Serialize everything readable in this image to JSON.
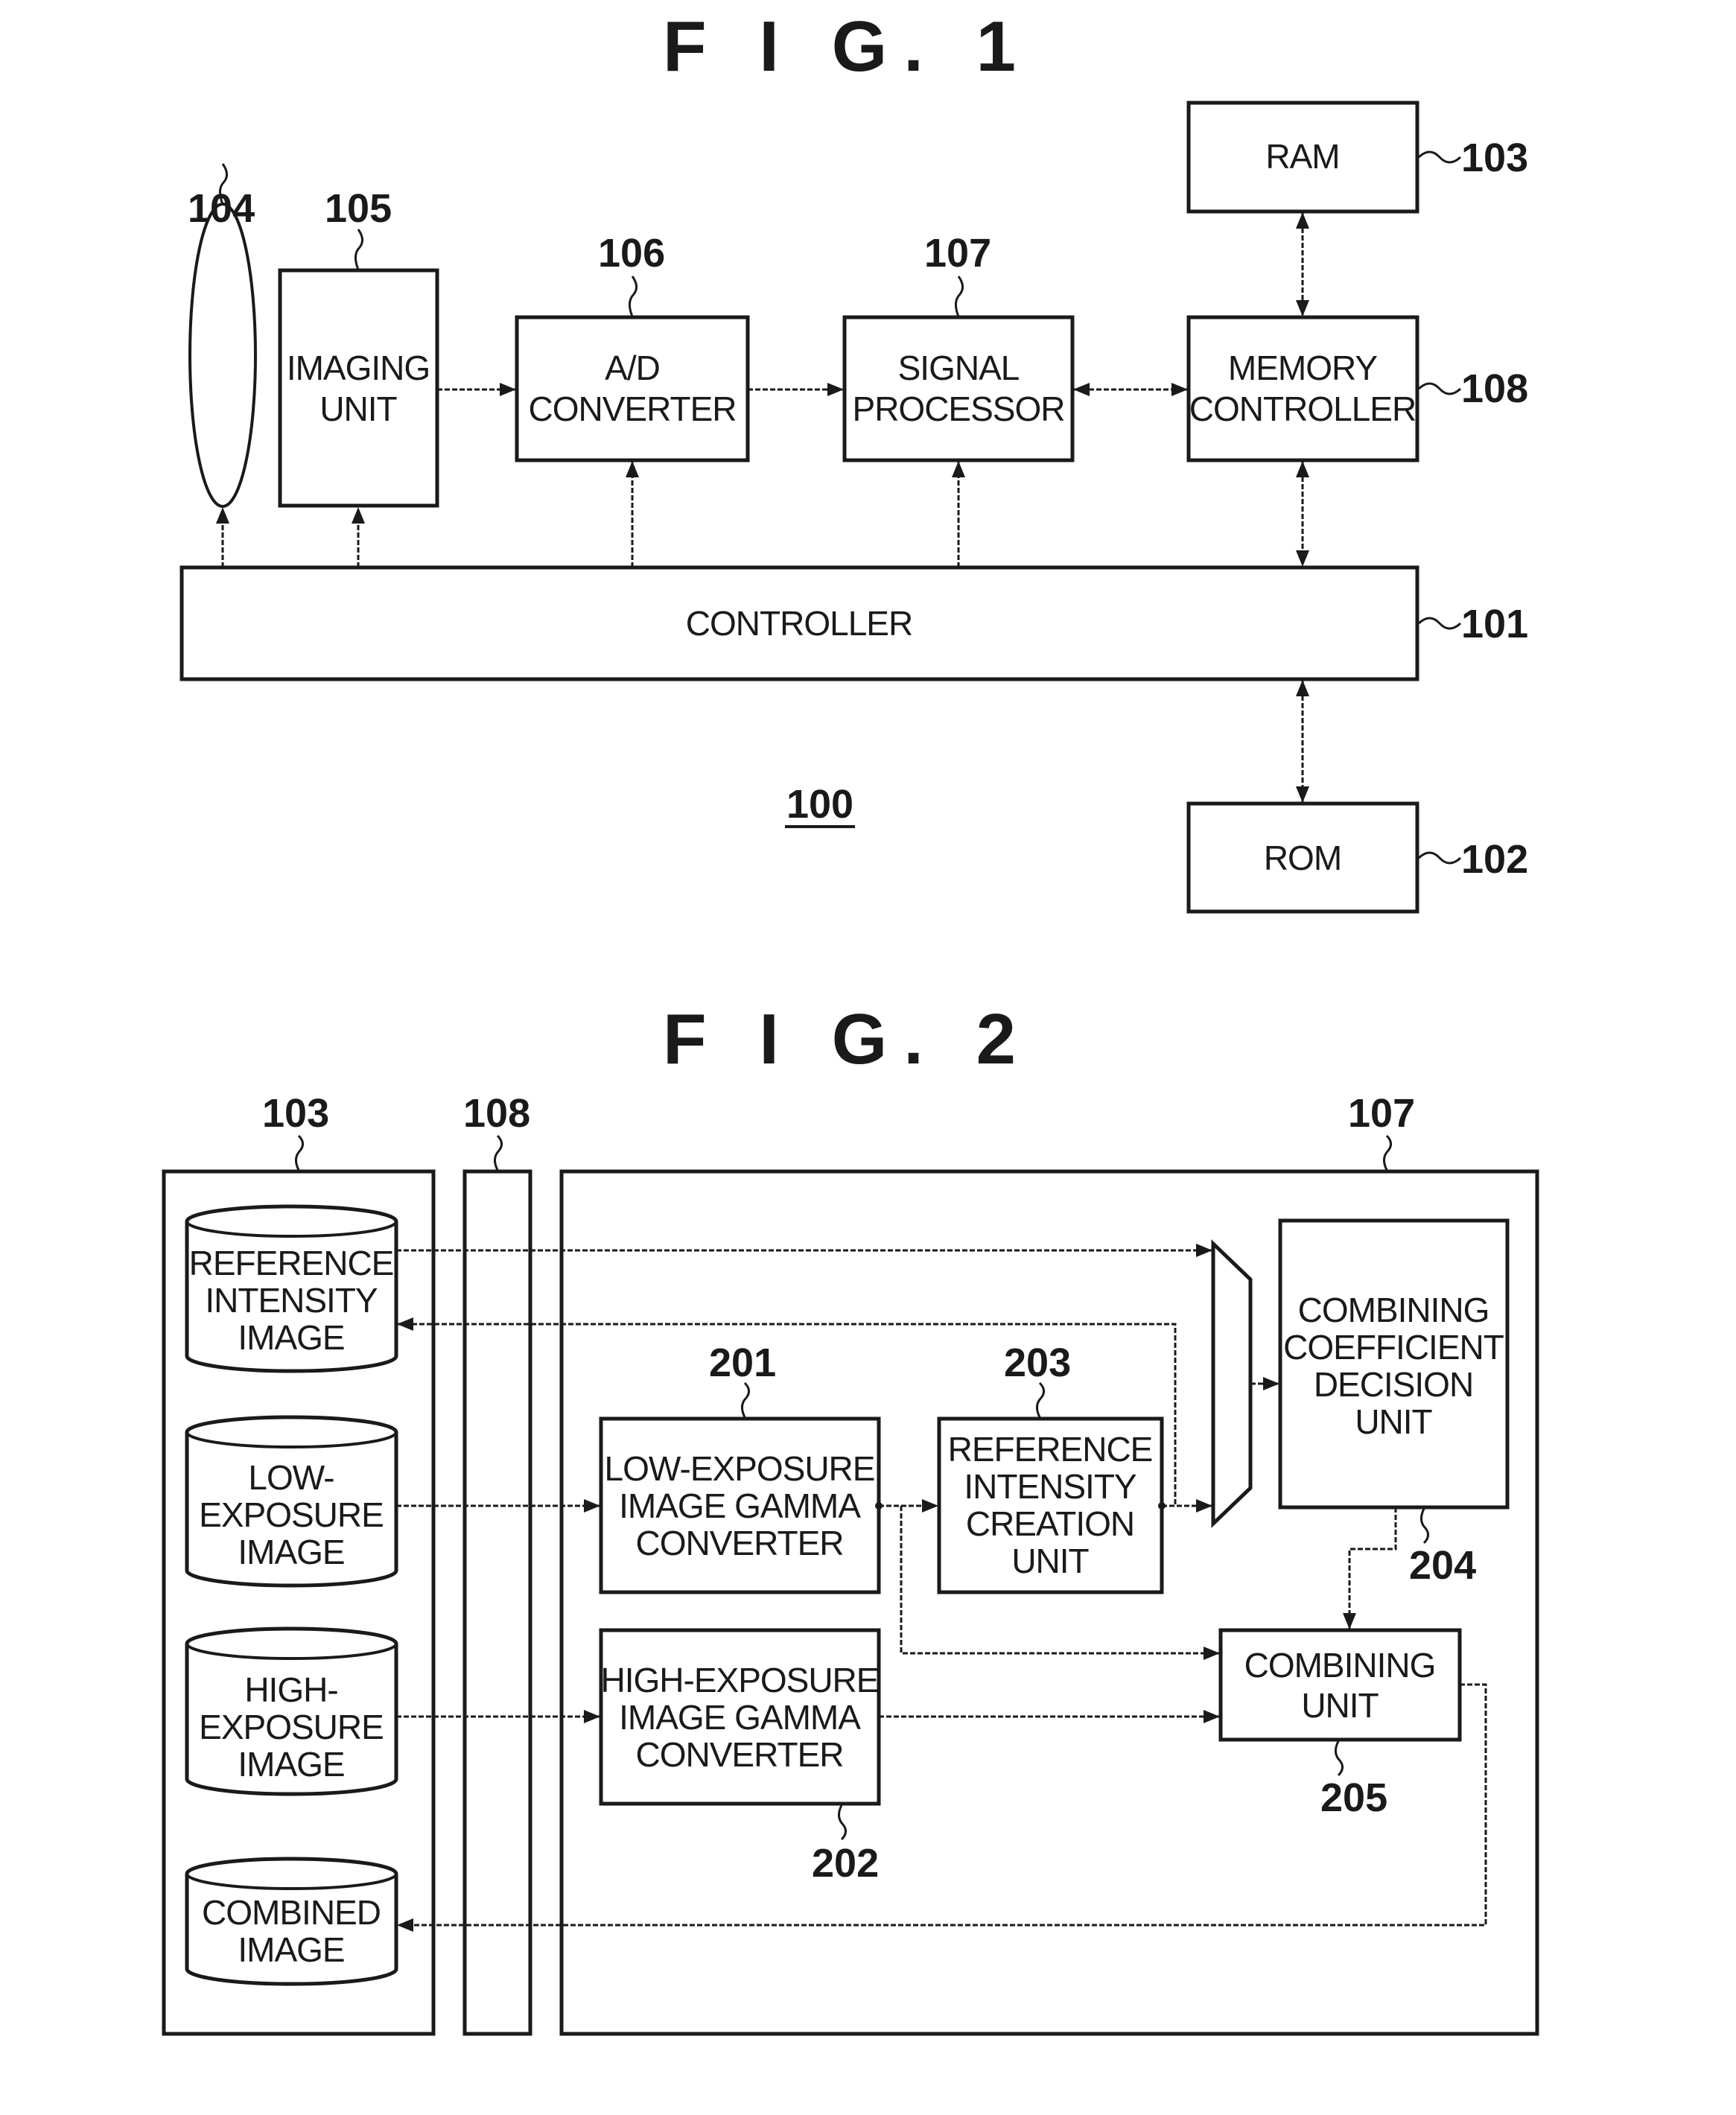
{
  "fig1": {
    "title": "F I G. 1",
    "system_label": "100",
    "blocks": {
      "lens": {
        "ref": "104"
      },
      "imaging_unit": {
        "ref": "105",
        "lines": [
          "IMAGING",
          "UNIT"
        ]
      },
      "ad_converter": {
        "ref": "106",
        "lines": [
          "A/D",
          "CONVERTER"
        ]
      },
      "signal_processor": {
        "ref": "107",
        "lines": [
          "SIGNAL",
          "PROCESSOR"
        ]
      },
      "memory_controller": {
        "ref": "108",
        "lines": [
          "MEMORY",
          "CONTROLLER"
        ]
      },
      "ram": {
        "ref": "103",
        "lines": [
          "RAM"
        ]
      },
      "controller": {
        "ref": "101",
        "lines": [
          "CONTROLLER"
        ]
      },
      "rom": {
        "ref": "102",
        "lines": [
          "ROM"
        ]
      }
    }
  },
  "fig2": {
    "title": "F I G. 2",
    "containers": {
      "ram": {
        "ref": "103"
      },
      "memory_controller": {
        "ref": "108"
      },
      "signal_processor": {
        "ref": "107"
      }
    },
    "storage": {
      "reference_intensity_image": {
        "lines": [
          "REFERENCE",
          "INTENSITY",
          "IMAGE"
        ]
      },
      "low_exposure_image": {
        "lines": [
          "LOW-",
          "EXPOSURE",
          "IMAGE"
        ]
      },
      "high_exposure_image": {
        "lines": [
          "HIGH-",
          "EXPOSURE",
          "IMAGE"
        ]
      },
      "combined_image": {
        "lines": [
          "COMBINED",
          "IMAGE"
        ]
      }
    },
    "units": {
      "low_gamma": {
        "ref": "201",
        "lines": [
          "LOW-EXPOSURE",
          "IMAGE GAMMA",
          "CONVERTER"
        ]
      },
      "high_gamma": {
        "ref": "202",
        "lines": [
          "HIGH-EXPOSURE",
          "IMAGE GAMMA",
          "CONVERTER"
        ]
      },
      "ref_intensity_creation": {
        "ref": "203",
        "lines": [
          "REFERENCE",
          "INTENSITY",
          "CREATION",
          "UNIT"
        ]
      },
      "coefficient_decision": {
        "ref": "204",
        "lines": [
          "COMBINING",
          "COEFFICIENT",
          "DECISION",
          "UNIT"
        ]
      },
      "combining_unit": {
        "ref": "205",
        "lines": [
          "COMBINING",
          "UNIT"
        ]
      }
    }
  }
}
